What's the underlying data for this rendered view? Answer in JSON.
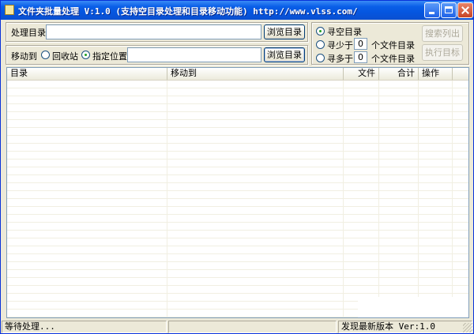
{
  "window": {
    "title": "文件夹批量处理 V:1.0 (支持空目录处理和目录移动功能) http://www.vlss.com/"
  },
  "source_row": {
    "label": "处理目录",
    "path_value": "",
    "browse_label": "浏览目录"
  },
  "move_row": {
    "label": "移动到",
    "radio_recycle_label": "回收站",
    "radio_specified_label": "指定位置",
    "recycle_selected": false,
    "specified_selected": true,
    "path_value": "",
    "browse_label": "浏览目录"
  },
  "search_mode": {
    "empty_label": "寻空目录",
    "less_prefix": "寻少于",
    "less_value": "0",
    "less_suffix": "个文件目录",
    "more_prefix": "寻多于",
    "more_value": "0",
    "more_suffix": "个文件目录",
    "selected": "empty"
  },
  "actions": {
    "search_label": "搜索列出",
    "execute_label": "执行目标",
    "search_enabled": false,
    "execute_enabled": false
  },
  "table": {
    "columns": [
      "目录",
      "移动到",
      "文件",
      "合计",
      "操作"
    ],
    "rows": []
  },
  "statusbar": {
    "left": "等待处理...",
    "middle": "",
    "right": "发现最新版本 Ver:1.0"
  }
}
